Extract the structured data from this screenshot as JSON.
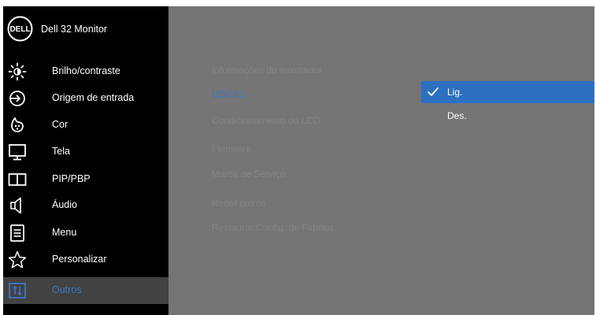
{
  "osd": {
    "brand_logo_icon": "dell-logo",
    "monitor_name": "Dell 32 Monitor"
  },
  "menu": [
    {
      "icon": "brightness-icon",
      "label": "Brilho/contraste",
      "active": false
    },
    {
      "icon": "input-source-icon",
      "label": "Origem de entrada",
      "active": false
    },
    {
      "icon": "color-palette-icon",
      "label": "Cor",
      "active": false
    },
    {
      "icon": "display-icon",
      "label": "Tela",
      "active": false
    },
    {
      "icon": "pip-pbp-icon",
      "label": "PIP/PBP",
      "active": false
    },
    {
      "icon": "speaker-icon",
      "label": "Áudio",
      "active": false
    },
    {
      "icon": "menu-list-icon",
      "label": "Menu",
      "active": false
    },
    {
      "icon": "star-icon",
      "label": "Personalizar",
      "active": false
    },
    {
      "icon": "others-icon",
      "label": "Outros",
      "active": true
    }
  ],
  "submenu": [
    {
      "label": "Informações do mostrador",
      "selected": false
    },
    {
      "label": "DDC/CI",
      "selected": true
    },
    {
      "label": "Condicionamento do LCD",
      "selected": false
    },
    {
      "label": "Firmware",
      "selected": false
    },
    {
      "label": "Marca de Serviço",
      "selected": false
    },
    {
      "label": "Redef outros",
      "selected": false
    },
    {
      "label": "Restaurar Config. de Fábrica",
      "selected": false
    }
  ],
  "ddc_options": {
    "on_label": "Lig.",
    "off_label": "Des.",
    "selected": "Lig."
  },
  "colors": {
    "accent_blue": "#2d70c2",
    "selected_text_blue": "#3a78c6",
    "sidebar_bg": "#000000",
    "panel_bg": "#757575"
  }
}
